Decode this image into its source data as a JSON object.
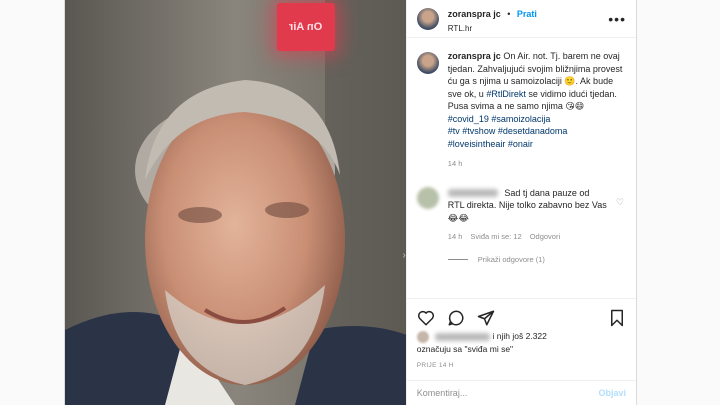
{
  "header": {
    "username": "zoranspr ajc",
    "username_display": "zoranspra jc",
    "follow_separator": "•",
    "follow_label": "Prati",
    "location": "RTL.hr",
    "more_icon": "more-horizontal-icon"
  },
  "photo": {
    "sign_text": "On Air",
    "description_icon": "portrait-photo"
  },
  "caption": {
    "username": "zoranspra jc",
    "text": "On Air. not. Tj. barem ne ovaj tjedan. Zahvaljujući svojim bližnjima provest ću ga s njima u samoizolaciji 🙂. Ak bude sve ok, u",
    "tag_inline": "#RtlDirekt",
    "text2": "se vidimo idući tjedan. Pusa svima a ne samo njima 😘😄",
    "tags": [
      "#covid_19 #samoizolacija",
      "#tv #tvshow #desetdanadoma",
      "#loveisintheair #onair"
    ],
    "time": "14 h"
  },
  "comment": {
    "text": "Sad tj dana pauze od RTL direkta. Nije tolko zabavno bez Vas 😂😂",
    "time": "14 h",
    "likes": "Sviđa mi se: 12",
    "reply": "Odgovori",
    "view_replies": "Prikaži odgovore (1)"
  },
  "likes": {
    "line1": "i njih još 2.322",
    "line2": "označuju sa \"sviđa mi se\""
  },
  "posted": "PRIJE 14 H",
  "add_comment": {
    "placeholder": "Komentiraj...",
    "post_label": "Objavi"
  },
  "colors": {
    "accent": "#0095f6",
    "hashtag": "#00376b",
    "muted": "#8e8e8e"
  }
}
